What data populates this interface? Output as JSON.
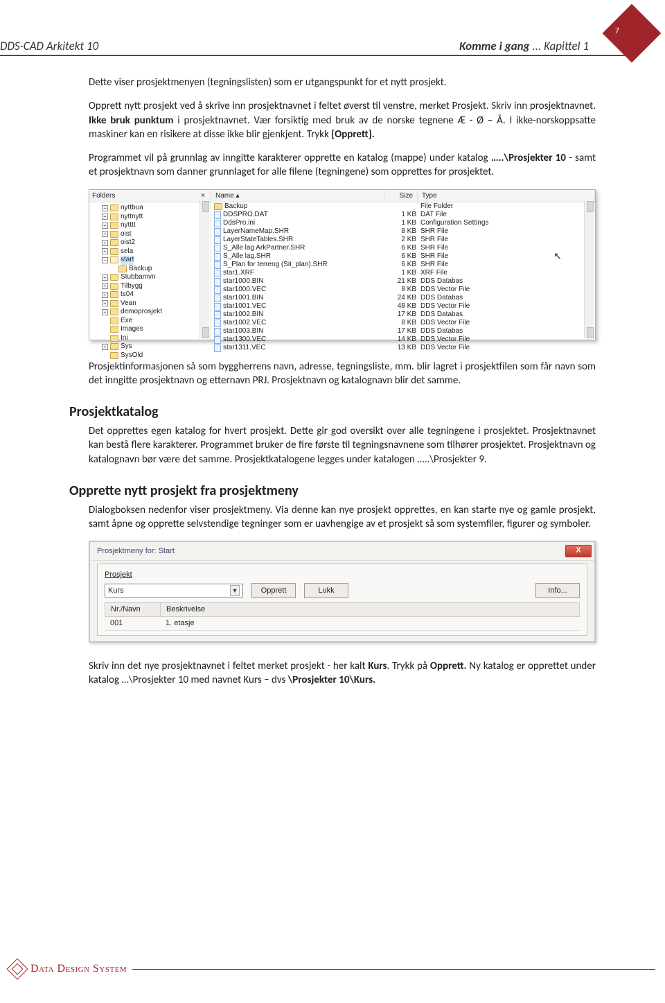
{
  "page_number": "7",
  "header": {
    "left": "DDS-CAD Arkitekt 10",
    "right_bold": "Komme i gang",
    "right_rest": " ... Kapittel 1"
  },
  "paragraphs": {
    "p1": "Dette viser prosjektmenyen (tegningslisten) som er utgangspunkt for et nytt prosjekt.",
    "p2a": "Opprett nytt prosjekt ved å skrive inn prosjektnavnet i feltet øverst til venstre, merket Prosjekt. Skriv inn prosjektnavnet. ",
    "p2b": "Ikke bruk punktum",
    "p2c": " i prosjektnavnet. Vær forsiktig med bruk av de norske tegnene Æ - Ø – Å. I ikke-norskoppsatte maskiner kan en risikere at disse ikke blir gjenkjent. Trykk ",
    "p2d": "[Opprett].",
    "p3a": "Programmet vil på grunnlag av inngitte karakterer opprette en katalog (mappe) under katalog ",
    "p3b": "…..\\Prosjekter 10",
    "p3c": " - samt et prosjektnavn som danner grunnlaget for alle filene (tegningene) som opprettes for prosjektet.",
    "p4": "Prosjektinformasjonen så som byggherrens navn, adresse, tegningsliste, mm. blir lagret i prosjektfilen som får navn som det inngitte prosjektnavn og etternavn PRJ. Prosjektnavn og katalognavn blir det samme.",
    "h_katalog": "Prosjektkatalog",
    "p5": "Det opprettes egen katalog for hvert prosjekt. Dette gir god oversikt over alle tegningene i prosjektet. Prosjektnavnet kan bestå flere karakterer. Programmet bruker de fire første til tegningsnavnene som tilhører prosjektet. Prosjektnavn og katalognavn bør være det samme. Prosjektkatalogene legges under katalogen …..\\Prosjekter 9.",
    "h_opprette": "Opprette nytt prosjekt fra prosjektmeny",
    "p6": "Dialogboksen nedenfor viser prosjektmeny. Via denne kan nye prosjekt opprettes, en kan starte nye og gamle prosjekt, samt åpne og opprette selvstendige tegninger som er uavhengige av et prosjekt så som systemfiler, figurer og symboler.",
    "p7a": "Skriv inn det nye prosjektnavnet i feltet merket prosjekt - her kalt ",
    "p7b": "Kurs",
    "p7c": ". Trykk på ",
    "p7d": "Opprett.",
    "p7e": " Ny katalog er opprettet under katalog …\\Prosjekter 10 med navnet Kurs – dvs ",
    "p7f": "\\Prosjekter 10\\Kurs."
  },
  "shot1": {
    "folders_label": "Folders",
    "close": "×",
    "tree": [
      {
        "exp": "+",
        "label": "nyttbua"
      },
      {
        "exp": "+",
        "label": "nyttnytt"
      },
      {
        "exp": "+",
        "label": "nytttt"
      },
      {
        "exp": "+",
        "label": "oist"
      },
      {
        "exp": "+",
        "label": "oist2"
      },
      {
        "exp": "+",
        "label": "sela"
      },
      {
        "exp": "−",
        "label": "start",
        "open": true,
        "sel": true
      },
      {
        "exp": "",
        "label": "Backup",
        "indent": 1
      },
      {
        "exp": "+",
        "label": "Stubbamvn"
      },
      {
        "exp": "+",
        "label": "Tilbygg"
      },
      {
        "exp": "+",
        "label": "ts04"
      },
      {
        "exp": "+",
        "label": "Vean"
      },
      {
        "exp": "+",
        "label": "demoprosjekt",
        "indent": -1
      },
      {
        "exp": "",
        "label": "Exe",
        "indent": -1
      },
      {
        "exp": "",
        "label": "Images",
        "indent": -1
      },
      {
        "exp": "",
        "label": "Ini",
        "indent": -1
      },
      {
        "exp": "+",
        "label": "Sys",
        "indent": -1
      },
      {
        "exp": "",
        "label": "SysOld",
        "indent": -1
      }
    ],
    "cols": {
      "name": "Name  ▴",
      "size": "Size",
      "type": "Type"
    },
    "rows": [
      {
        "name": "Backup",
        "size": "",
        "type": "File Folder",
        "icon": "folder"
      },
      {
        "name": "DDSPRO.DAT",
        "size": "1 KB",
        "type": "DAT File"
      },
      {
        "name": "DdsPro.ini",
        "size": "1 KB",
        "type": "Configuration Settings"
      },
      {
        "name": "LayerNameMap.SHR",
        "size": "8 KB",
        "type": "SHR File"
      },
      {
        "name": "LayerStateTables.SHR",
        "size": "2 KB",
        "type": "SHR File"
      },
      {
        "name": "S_Alle lag ArkPartner.SHR",
        "size": "6 KB",
        "type": "SHR File"
      },
      {
        "name": "S_Alle lag.SHR",
        "size": "6 KB",
        "type": "SHR File"
      },
      {
        "name": "S_Plan for terreng (Sit_plan).SHR",
        "size": "6 KB",
        "type": "SHR File"
      },
      {
        "name": "star1.XRF",
        "size": "1 KB",
        "type": "XRF File"
      },
      {
        "name": "star1000.BIN",
        "size": "21 KB",
        "type": "DDS Databas"
      },
      {
        "name": "star1000.VEC",
        "size": "8 KB",
        "type": "DDS Vector File"
      },
      {
        "name": "star1001.BIN",
        "size": "24 KB",
        "type": "DDS Databas"
      },
      {
        "name": "star1001.VEC",
        "size": "48 KB",
        "type": "DDS Vector File"
      },
      {
        "name": "star1002.BIN",
        "size": "17 KB",
        "type": "DDS Databas"
      },
      {
        "name": "star1002.VEC",
        "size": "8 KB",
        "type": "DDS Vector File"
      },
      {
        "name": "star1003.BIN",
        "size": "17 KB",
        "type": "DDS Databas"
      },
      {
        "name": "star1300.VEC",
        "size": "14 KB",
        "type": "DDS Vector File"
      },
      {
        "name": "star1311.VEC",
        "size": "13 KB",
        "type": "DDS Vector File"
      }
    ]
  },
  "shot2": {
    "title": "Prosjektmeny for: Start",
    "close": "X",
    "label_prosjekt": "Prosjekt",
    "combo_value": "Kurs",
    "btn_opprett": "Opprett",
    "btn_lukk": "Lukk",
    "btn_info": "Info...",
    "col_nr": "Nr./Navn",
    "col_besk": "Beskrivelse",
    "row_nr": "001",
    "row_besk": "1. etasje"
  },
  "footer_brand": "Data Design System"
}
